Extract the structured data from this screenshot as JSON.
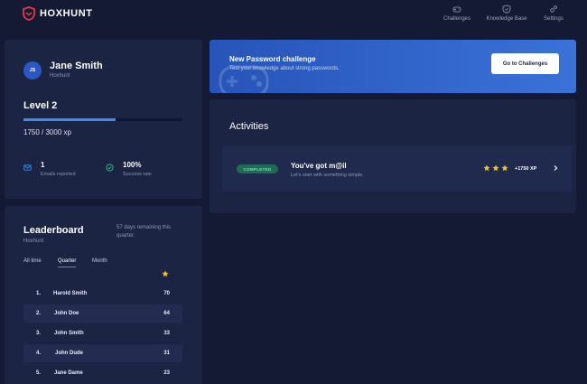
{
  "app": {
    "name": "HOXHUNT"
  },
  "nav": {
    "challenges": "Challenges",
    "knowledge_base": "Knowledge Base",
    "settings": "Settings"
  },
  "profile": {
    "initials": "JS",
    "name": "Jane Smith",
    "organization": "Hoxhunt",
    "level": "Level 2",
    "xp_text": "1750 / 3000 xp",
    "xp_progress": 0.58,
    "emails_reported_value": "1",
    "emails_reported_label": "Emails reported",
    "success_rate_value": "100%",
    "success_rate_label": "Success rate"
  },
  "leaderboard": {
    "title": "Leaderboard",
    "organization": "Hoxhunt",
    "remaining": "57 days remaining this quarter.",
    "tabs": [
      "All time",
      "Quarter",
      "Month"
    ],
    "active_tab": "Quarter",
    "rows": [
      {
        "rank": "1.",
        "name": "Harold Smith",
        "score": "70"
      },
      {
        "rank": "2.",
        "name": "John Doe",
        "score": "64"
      },
      {
        "rank": "3.",
        "name": "John Smith",
        "score": "33"
      },
      {
        "rank": "4.",
        "name": "John Dude",
        "score": "31"
      },
      {
        "rank": "5.",
        "name": "Jane Dame",
        "score": "23"
      }
    ]
  },
  "banner": {
    "title": "New Password challenge",
    "subtitle": "Test your knowledge about strong passwords.",
    "button": "Go to Challenges"
  },
  "activities": {
    "title": "Activities",
    "items": [
      {
        "status": "COMPLETED",
        "name": "You've got m@il",
        "description": "Let's start with something simple.",
        "stars": 3,
        "xp": "+1750 XP"
      }
    ]
  },
  "colors": {
    "background": "#141a33",
    "card": "#1c2444",
    "accent": "#3a8ff0",
    "star": "#f5c518",
    "completed": "#1f6b57"
  }
}
